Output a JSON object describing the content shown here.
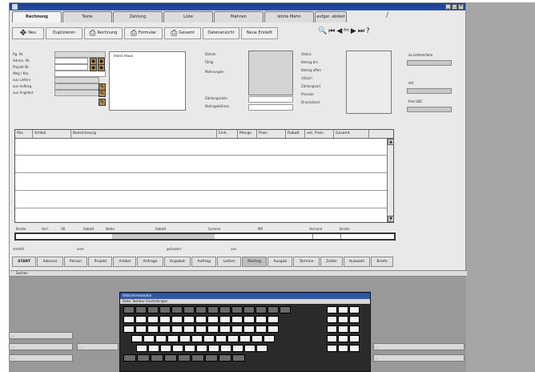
{
  "window": {
    "tabs": [
      {
        "label": "Rechnung",
        "active": true
      },
      {
        "label": "Texte",
        "active": false
      },
      {
        "label": "Zahlung",
        "active": false
      },
      {
        "label": "Liste",
        "active": false
      },
      {
        "label": "Mahnen",
        "active": false
      },
      {
        "label": "letzte Mahn",
        "active": false
      },
      {
        "label": "aufger. abliest",
        "active": false
      }
    ]
  },
  "toolbar": {
    "new_label": "Neu",
    "copy_label": "Duplizieren",
    "invoice_label": "Rechnung",
    "form_label": "Formular",
    "settings_label": "Gesamt",
    "extract_label": "Datenansicht",
    "create_label": "Neue Erstellt"
  },
  "header_fields": {
    "rg_nr": "Rg. Nr.",
    "adresse": "Adress. Nr.",
    "projekt": "Projekt Nr.",
    "weg": "Weg / Kto.",
    "aus_liefern": "aus Liefern",
    "aus_auftrag": "aus Auftrag",
    "aus_angebot": "aus Angebot",
    "address_name": "Hans Haus",
    "datum": "Datum",
    "faellig": "Fällig",
    "mahnungen": "Mahnungen",
    "zahlungsziele": "Zahlungsziele",
    "mahngebuehren": "Mahngebühren",
    "status": "Status",
    "betrag_brutto": "Betrag brt.",
    "betrag_offen": "Betrag offen",
    "skonto": "vStüch",
    "zahlungsart": "Zahlungsart",
    "provision": "Provisor",
    "druckstand": "Druckstand"
  },
  "side_panel": {
    "last_item": "zu Lieferschein",
    "a": "Art:",
    "b": "free UID:"
  },
  "grid": {
    "columns": [
      "Pos.",
      "Artikel",
      "Bezeichnung",
      "Einh.",
      "Menge",
      "Preis",
      "Rabatt",
      "ext. Preis",
      "Gesamt"
    ]
  },
  "totals": {
    "labels": [
      "Brutto",
      "Vorl.",
      "UR",
      "Rabatt",
      "Netto",
      "Rabatt",
      "Summe",
      "MR",
      "Versand",
      "Brutto"
    ],
    "sub_labels": [
      "erstellt",
      "vom",
      "geändert",
      "von"
    ]
  },
  "buttons": [
    "START",
    "Adresse",
    "Person",
    "Projekt",
    "Artikel",
    "Anfrage",
    "Angebot",
    "Auftrag",
    "Liefers",
    "Rechng",
    "Ausgab",
    "Termine",
    "Zettel",
    "Auswahl",
    "Briefe"
  ],
  "statusbar": "Suchen",
  "keyboard": {
    "title": "Bildschirmtastatur",
    "menu": "Datei  Tastatur  Einstellungen"
  },
  "taskbar_items": [
    "...",
    "...",
    "...",
    "...",
    "...",
    "..."
  ]
}
